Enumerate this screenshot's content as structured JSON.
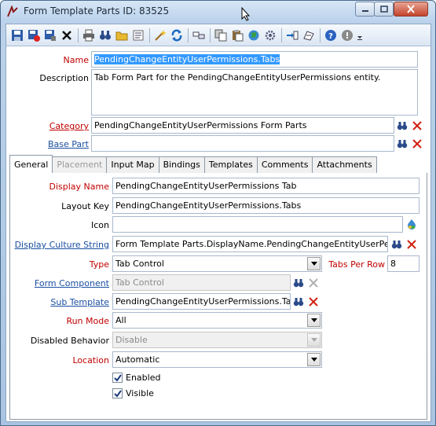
{
  "window": {
    "title": "Form Template Parts ID: 83525"
  },
  "toolbar": {
    "icons": [
      "save-icon",
      "save-close-icon",
      "save-as-icon",
      "delete-icon",
      "print-icon",
      "find-icon",
      "open-folder-icon",
      "properties-icon",
      "wizard-icon",
      "refresh-icon",
      "link-icon",
      "copy-icon",
      "paste-icon",
      "globe-icon",
      "settings-icon",
      "import-icon",
      "export-icon",
      "help-icon",
      "info-icon",
      "more-icon"
    ]
  },
  "form": {
    "name": {
      "label": "Name",
      "value": "PendingChangeEntityUserPermissions.Tabs"
    },
    "description": {
      "label": "Description",
      "value": "Tab Form Part for the PendingChangeEntityUserPermissions entity."
    },
    "category": {
      "label": "Category",
      "value": "PendingChangeEntityUserPermissions Form Parts"
    },
    "base_part": {
      "label": "Base Part",
      "value": ""
    }
  },
  "tabs": [
    {
      "label": "General"
    },
    {
      "label": "Placement"
    },
    {
      "label": "Input Map"
    },
    {
      "label": "Bindings"
    },
    {
      "label": "Templates"
    },
    {
      "label": "Comments"
    },
    {
      "label": "Attachments"
    }
  ],
  "general": {
    "display_name": {
      "label": "Display Name",
      "value": "PendingChangeEntityUserPermissions Tab"
    },
    "layout_key": {
      "label": "Layout Key",
      "value": "PendingChangeEntityUserPermissions.Tabs"
    },
    "icon": {
      "label": "Icon",
      "value": ""
    },
    "display_culture_string": {
      "label": "Display Culture String",
      "value": "Form Template Parts.DisplayName.PendingChangeEntityUserPermiss"
    },
    "type": {
      "label": "Type",
      "value": "Tab Control"
    },
    "tabs_per_row": {
      "label": "Tabs Per Row",
      "value": "8"
    },
    "form_component": {
      "label": "Form Component",
      "value": "Tab Control"
    },
    "sub_template": {
      "label": "Sub Template",
      "value": "PendingChangeEntityUserPermissions.Tabs"
    },
    "run_mode": {
      "label": "Run Mode",
      "value": "All"
    },
    "disabled_behavior": {
      "label": "Disabled Behavior",
      "value": "Disable"
    },
    "location": {
      "label": "Location",
      "value": "Automatic"
    },
    "enabled": {
      "label": "Enabled",
      "checked": true
    },
    "visible": {
      "label": "Visible",
      "checked": true
    }
  }
}
